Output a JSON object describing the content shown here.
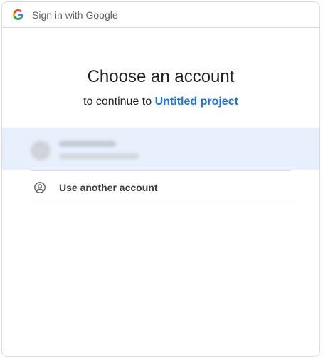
{
  "header": {
    "logo_icon": "google-g-icon",
    "text": "Sign in with Google"
  },
  "main": {
    "title": "Choose an account",
    "subtitle_prefix": "to continue to",
    "project_name": "Untitled project"
  },
  "accounts": [
    {
      "avatar_icon": "avatar-icon",
      "selected": true
    }
  ],
  "other_account": {
    "icon": "account-circle-icon",
    "label": "Use another account"
  },
  "colors": {
    "accent": "#1a73e8",
    "selected_row": "#e8f0fe",
    "border": "#dadce0"
  }
}
